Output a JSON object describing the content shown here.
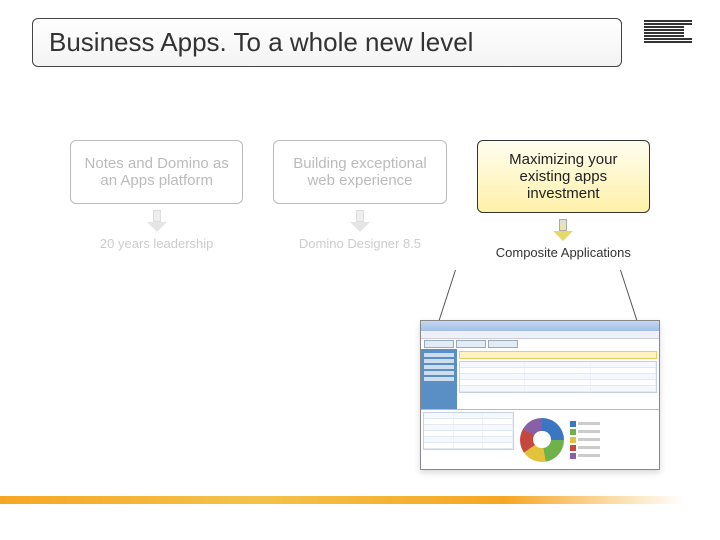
{
  "title": "Business Apps. To a whole new level",
  "logo": "IBM",
  "columns": [
    {
      "box": "Notes and Domino as an Apps platform",
      "label": "20 years leadership",
      "highlight": false
    },
    {
      "box": "Building exceptional web experience",
      "label": "Domino Designer 8.5",
      "highlight": false
    },
    {
      "box": "Maximizing your existing apps investment",
      "label": "Composite Applications",
      "highlight": true
    }
  ]
}
